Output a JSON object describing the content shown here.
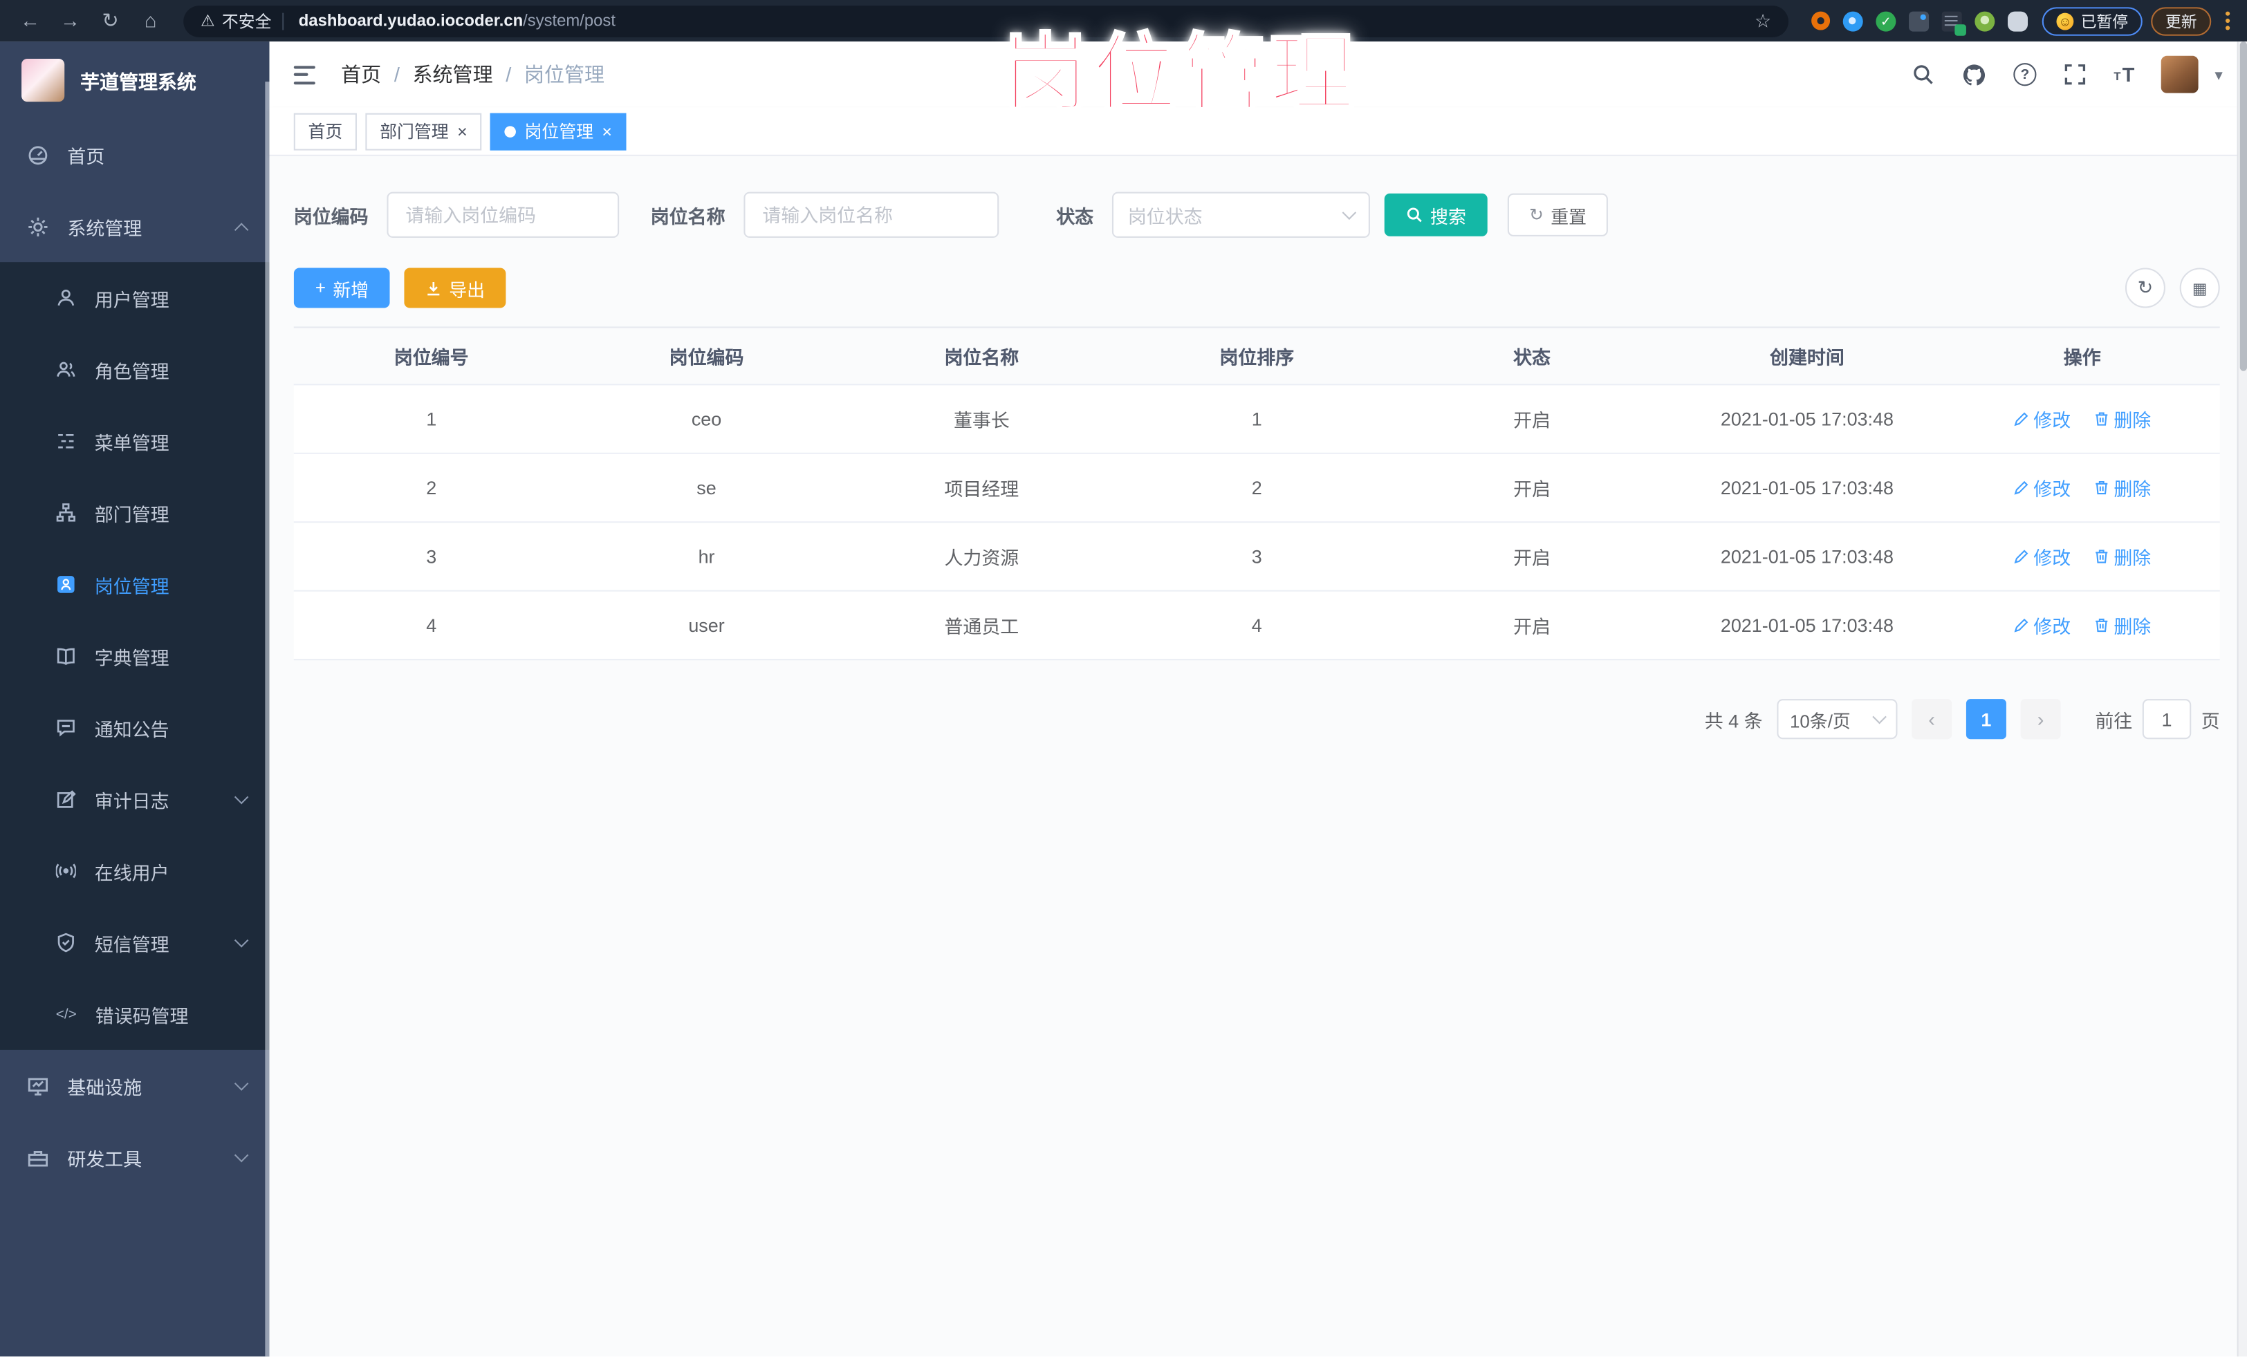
{
  "browser": {
    "security_label": "不安全",
    "url_domain": "dashboard.yudao.iocoder.cn",
    "url_path": "/system/post",
    "paused_badge": "已暂停",
    "update_label": "更新"
  },
  "icons": {
    "back": "←",
    "forward": "→",
    "reload": "↻",
    "home": "⌂",
    "warning": "⚠",
    "star": "☆",
    "smiley": "☺",
    "question": "?",
    "caret_down": "▾",
    "close": "×",
    "plus": "+",
    "check": "✓",
    "grid": "▦",
    "font_size": "T",
    "chevron_left": "‹",
    "chevron_right": "›",
    "code": "</>"
  },
  "watermark_text": "岗位管理",
  "sidebar": {
    "app_title": "芋道管理系统",
    "home": "首页",
    "system": "系统管理",
    "submenu": [
      {
        "label": "用户管理"
      },
      {
        "label": "角色管理"
      },
      {
        "label": "菜单管理"
      },
      {
        "label": "部门管理"
      },
      {
        "label": "岗位管理"
      },
      {
        "label": "字典管理"
      },
      {
        "label": "通知公告"
      },
      {
        "label": "审计日志"
      },
      {
        "label": "在线用户"
      },
      {
        "label": "短信管理"
      },
      {
        "label": "错误码管理"
      }
    ],
    "infra": "基础设施",
    "devtools": "研发工具"
  },
  "breadcrumb": {
    "home": "首页",
    "separator": "/",
    "section": "系统管理",
    "current": "岗位管理"
  },
  "tabs": [
    {
      "label": "首页"
    },
    {
      "label": "部门管理"
    },
    {
      "label": "岗位管理"
    }
  ],
  "filters": {
    "code_label": "岗位编码",
    "code_placeholder": "请输入岗位编码",
    "name_label": "岗位名称",
    "name_placeholder": "请输入岗位名称",
    "status_label": "状态",
    "status_placeholder": "岗位状态",
    "search": "搜索",
    "reset": "重置"
  },
  "toolbar": {
    "add": "新增",
    "export": "导出"
  },
  "table": {
    "columns": [
      "岗位编号",
      "岗位编码",
      "岗位名称",
      "岗位排序",
      "状态",
      "创建时间",
      "操作"
    ],
    "rows": [
      {
        "id": "1",
        "code": "ceo",
        "name": "董事长",
        "sort": "1",
        "status": "开启",
        "created_at": "2021-01-05 17:03:48"
      },
      {
        "id": "2",
        "code": "se",
        "name": "项目经理",
        "sort": "2",
        "status": "开启",
        "created_at": "2021-01-05 17:03:48"
      },
      {
        "id": "3",
        "code": "hr",
        "name": "人力资源",
        "sort": "3",
        "status": "开启",
        "created_at": "2021-01-05 17:03:48"
      },
      {
        "id": "4",
        "code": "user",
        "name": "普通员工",
        "sort": "4",
        "status": "开启",
        "created_at": "2021-01-05 17:03:48"
      }
    ],
    "edit": "修改",
    "delete": "删除"
  },
  "pagination": {
    "total": "共 4 条",
    "page_size": "10条/页",
    "current": "1",
    "goto": "前往",
    "goto_value": "1",
    "unit": "页"
  },
  "colors": {
    "accent": "#409eff",
    "search_green": "#14b8a6",
    "export_orange": "#efa51e",
    "watermark_pink": "#f43f5e",
    "sidebar_bg": "#36445f",
    "submenu_bg": "#1d2a3a"
  }
}
